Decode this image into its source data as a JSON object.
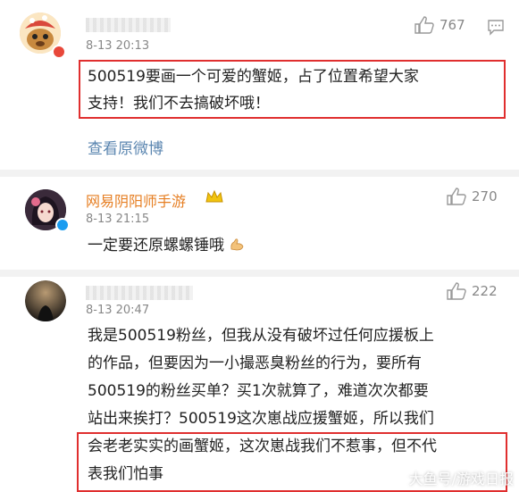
{
  "colors": {
    "link": "#5b86b0",
    "highlight": "#e02f2f",
    "username_orange": "#e67e22",
    "muted": "#888888"
  },
  "comments": [
    {
      "username": "",
      "time": "8-13 20:13",
      "likes": "767",
      "text_line1": "500519要画一个可爱的蟹姬，占了位置希望大家",
      "text_line2": "支持！我们不去搞破坏哦！",
      "link": "查看原微博",
      "avatar_icon": "cartoon-avatar-icon"
    },
    {
      "username": "网易阴阳师手游",
      "time": "8-13 21:15",
      "likes": "270",
      "text": "一定要还原螺螺锤哦",
      "emoji": "flexed-arm-icon"
    },
    {
      "username": "",
      "time": "8-13 20:47",
      "likes": "222",
      "lines": [
        "我是500519粉丝，但我从没有破坏过任何应援板上",
        "的作品，但要因为一小撮恶臭粉丝的行为，要所有",
        "500519的粉丝买单？买1次就算了，难道次次都要",
        "站出来挨打？500519这次崽战应援蟹姬，所以我们",
        "会老老实实的画蟹姬，这次崽战我们不惹事，但不代",
        "表我们怕事"
      ]
    }
  ],
  "watermark": "大鱼号/游戏日报"
}
